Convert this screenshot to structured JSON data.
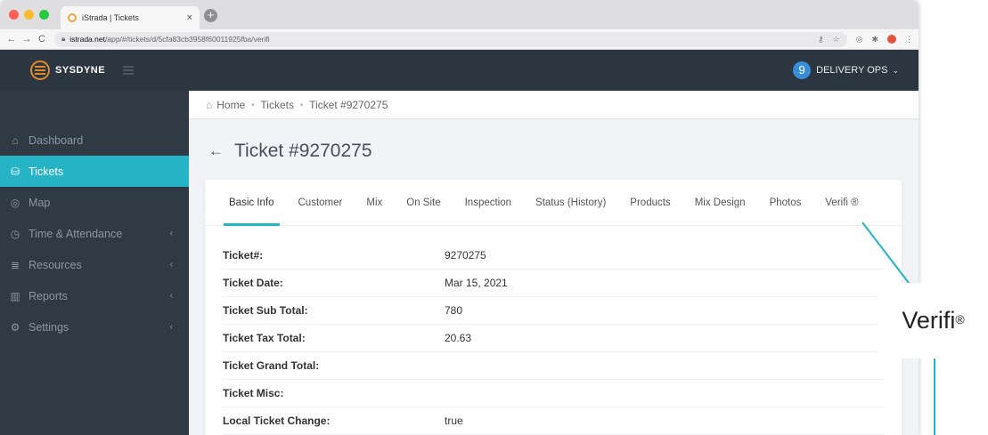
{
  "browser": {
    "tab_title": "iStrada | Tickets",
    "tab_close": "×",
    "new_tab": "+",
    "back": "←",
    "forward": "→",
    "reload": "C",
    "url_host": "istrada.net",
    "url_path": "/app/#/tickets/d/5cfa83cb3958f60011925fba/verifi"
  },
  "header": {
    "brand": "SYSDYNE",
    "ops_count": "9",
    "ops_label": "DELIVERY OPS",
    "ops_chevron": "⌄"
  },
  "sidebar": {
    "items": [
      {
        "label": "Dashboard",
        "icon": "⌂",
        "chevron": ""
      },
      {
        "label": "Tickets",
        "icon": "⛁",
        "chevron": ""
      },
      {
        "label": "Map",
        "icon": "◎",
        "chevron": ""
      },
      {
        "label": "Time & Attendance",
        "icon": "◷",
        "chevron": "‹"
      },
      {
        "label": "Resources",
        "icon": "≣",
        "chevron": "‹"
      },
      {
        "label": "Reports",
        "icon": "▥",
        "chevron": "‹"
      },
      {
        "label": "Settings",
        "icon": "⚙",
        "chevron": "‹"
      }
    ]
  },
  "breadcrumb": {
    "home_icon": "⌂",
    "home": "Home",
    "sep": "•",
    "tickets": "Tickets",
    "current": "Ticket #9270275"
  },
  "page": {
    "back": "←",
    "title": "Ticket #9270275"
  },
  "tabs": [
    "Basic Info",
    "Customer",
    "Mix",
    "On Site",
    "Inspection",
    "Status (History)",
    "Products",
    "Mix Design",
    "Photos",
    "Verifi ®"
  ],
  "details": [
    {
      "label": "Ticket#:",
      "value": "9270275"
    },
    {
      "label": "Ticket Date:",
      "value": "Mar 15, 2021"
    },
    {
      "label": "Ticket Sub Total:",
      "value": "780"
    },
    {
      "label": "Ticket Tax Total:",
      "value": "20.63"
    },
    {
      "label": "Ticket Grand Total:",
      "value": ""
    },
    {
      "label": "Ticket Misc:",
      "value": ""
    },
    {
      "label": "Local Ticket Change:",
      "value": "true"
    }
  ],
  "callout": {
    "text": "Verifi",
    "mark": "®"
  },
  "colors": {
    "accent": "#26b3c6",
    "sidebar_bg": "#2f3a45",
    "topbar_bg": "#2b3641"
  }
}
